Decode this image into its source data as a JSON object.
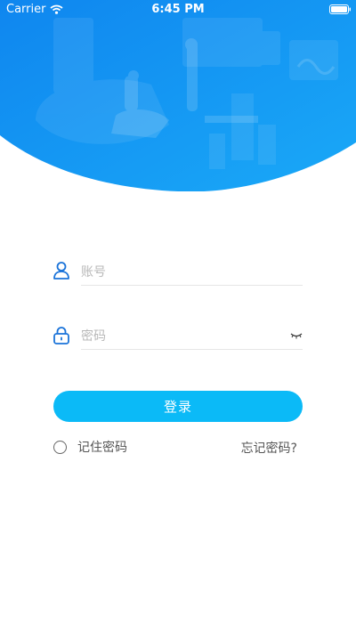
{
  "status_bar": {
    "carrier": "Carrier",
    "time": "6:45 PM"
  },
  "login_form": {
    "account_placeholder": "账号",
    "password_placeholder": "密码",
    "login_label": "登录",
    "remember_label": "记住密码",
    "forgot_label": "忘记密码?"
  },
  "colors": {
    "header_blue": "#1296f2",
    "button_blue": "#0bbaf7",
    "icon_blue": "#1a73d9"
  },
  "icons": {
    "account": "user-icon",
    "password": "lock-icon",
    "visibility": "eye-closed-icon",
    "remember": "radio-icon"
  }
}
